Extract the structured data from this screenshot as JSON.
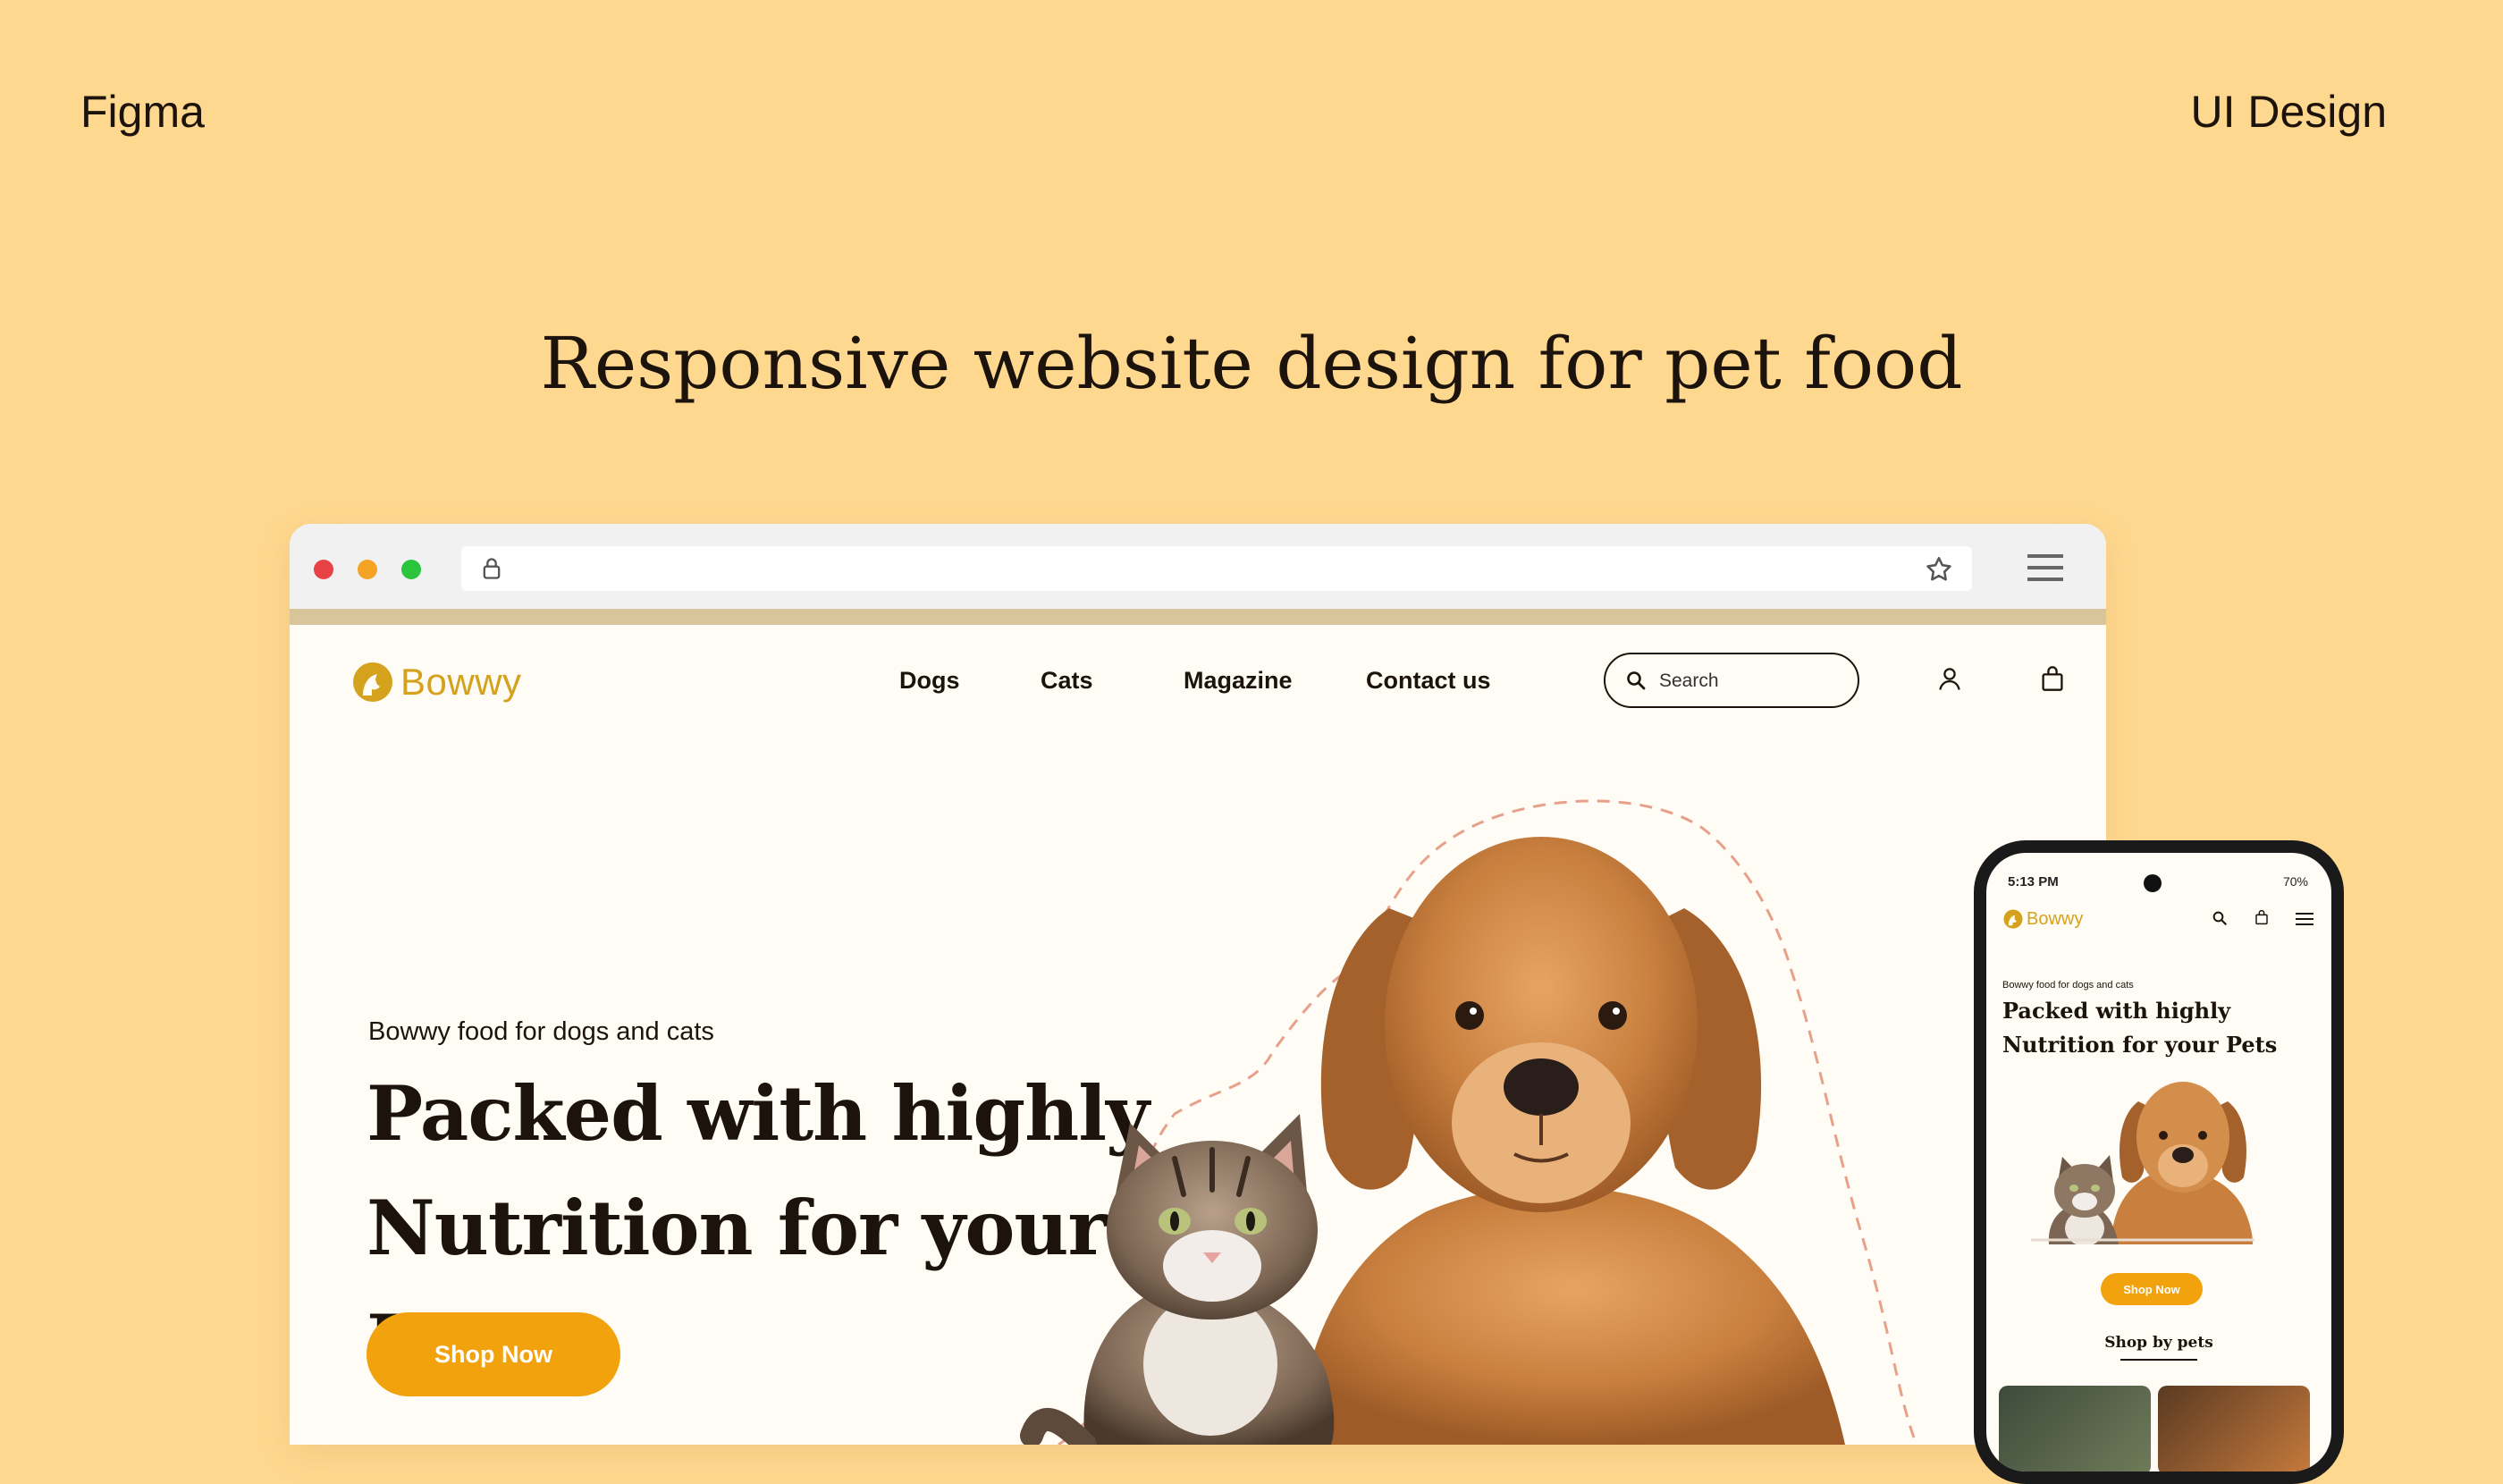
{
  "frame": {
    "left_label": "Figma",
    "right_label": "UI Design",
    "headline": "Responsive website design for pet food"
  },
  "browser": {
    "address_value": ""
  },
  "site": {
    "brand": "Bowwy",
    "nav": [
      "Dogs",
      "Cats",
      "Magazine",
      "Contact us"
    ],
    "search_placeholder": "Search",
    "hero": {
      "eyebrow": "Bowwy food for dogs and cats",
      "title_line1": "Packed with highly",
      "title_line2": "Nutrition for your Pets",
      "cta": "Shop Now"
    }
  },
  "mobile": {
    "status_time": "5:13 PM",
    "battery": "70%",
    "brand": "Bowwy",
    "eyebrow": "Bowwy food for dogs and cats",
    "title_line1": "Packed with highly",
    "title_line2": "Nutrition for your Pets",
    "cta": "Shop Now",
    "section_title": "Shop by pets"
  },
  "colors": {
    "background": "#FFD88F",
    "accent": "#F2A20C",
    "brand": "#D4A21C",
    "text": "#1c130c"
  },
  "icons": [
    "lock-icon",
    "star-icon",
    "menu-icon",
    "search-icon",
    "user-icon",
    "bag-icon"
  ]
}
